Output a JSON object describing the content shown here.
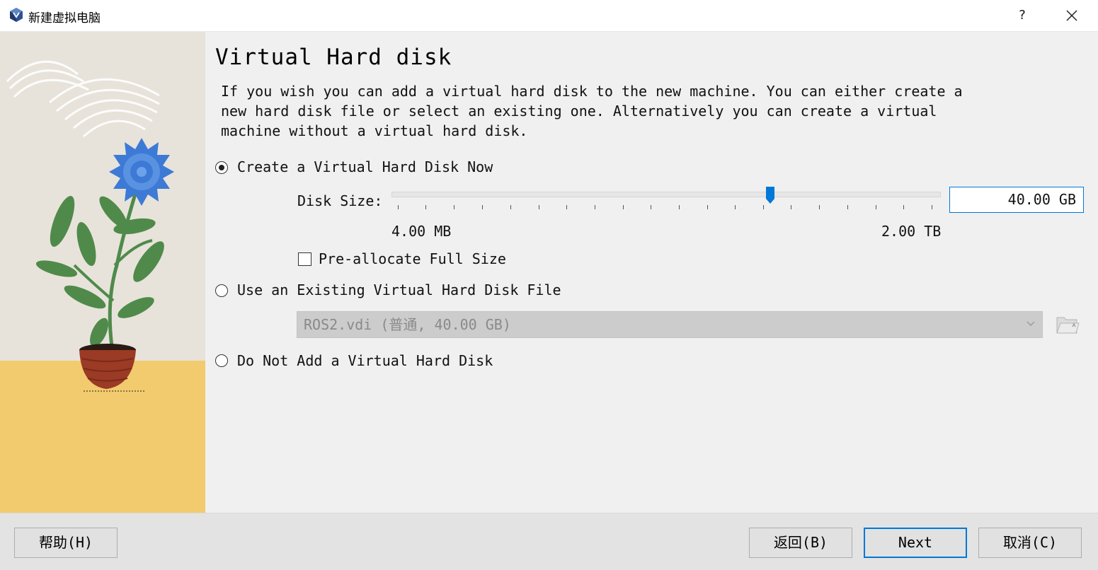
{
  "window": {
    "title": "新建虚拟电脑",
    "help_label": "?",
    "close_icon": "close-icon",
    "app_icon": "virtualbox-icon"
  },
  "page": {
    "title": "Virtual Hard disk",
    "description": "If you wish you can add a virtual hard disk to the new machine. You can either create a new hard disk file or select an existing one. Alternatively you can create a virtual machine without a virtual hard disk."
  },
  "options": {
    "create": {
      "label": "Create a Virtual Hard Disk Now",
      "selected": true
    },
    "disk_size_label": "Disk Size:",
    "disk_size_value": "40.00 GB",
    "slider_position": 0.69,
    "slider_min_label": "4.00 MB",
    "slider_max_label": "2.00 TB",
    "preallocate": {
      "label": "Pre-allocate Full Size",
      "checked": false
    },
    "existing": {
      "label": "Use an Existing Virtual Hard Disk File",
      "selected": false,
      "combo_value": "ROS2.vdi (普通, 40.00 GB)"
    },
    "none": {
      "label": "Do Not Add a Virtual Hard Disk",
      "selected": false
    }
  },
  "footer": {
    "help": "帮助(H)",
    "back": "返回(B)",
    "next": "Next",
    "cancel": "取消(C)"
  },
  "colors": {
    "accent": "#0078d7",
    "sidebar_bg": "#e7e3da",
    "sidebar_floor": "#f2cb6e",
    "flower": "#3d7ad6",
    "leaf": "#4f8a4a",
    "pot": "#9b3a25"
  }
}
